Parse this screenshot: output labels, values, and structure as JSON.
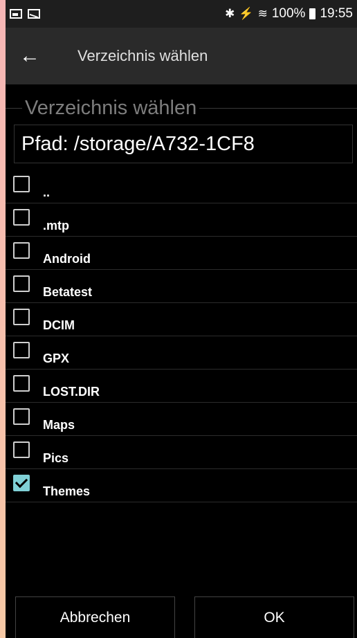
{
  "status_bar": {
    "left_icons": [
      "image-icon",
      "mail-icon"
    ],
    "right_glyphs": "✱ ⚡ ☸ .▎",
    "battery": "100%",
    "time": "19:55"
  },
  "toolbar": {
    "back_icon": "arrow-left-icon",
    "title": "Verzeichnis wählen"
  },
  "dialog": {
    "legend": "Verzeichnis wählen",
    "path": "Pfad: /storage/A732-1CF8"
  },
  "directories": [
    {
      "name": "..",
      "checked": false
    },
    {
      "name": ".mtp",
      "checked": false
    },
    {
      "name": "Android",
      "checked": false
    },
    {
      "name": "Betatest",
      "checked": false
    },
    {
      "name": "DCIM",
      "checked": false
    },
    {
      "name": "GPX",
      "checked": false
    },
    {
      "name": "LOST.DIR",
      "checked": false
    },
    {
      "name": "Maps",
      "checked": false
    },
    {
      "name": "Pics",
      "checked": false
    },
    {
      "name": "Themes",
      "checked": true
    }
  ],
  "buttons": {
    "cancel": "Abbrechen",
    "ok": "OK"
  },
  "colors": {
    "checkbox_checked": "#7fd0d6"
  }
}
